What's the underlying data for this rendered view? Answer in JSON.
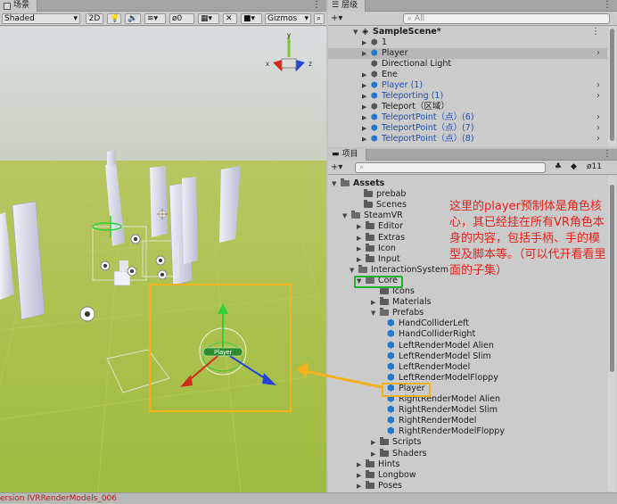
{
  "scene_panel": {
    "tab_label": "场景",
    "shading": "Shaded",
    "toggle_2d": "2D",
    "hidden_count": "0",
    "gizmos": "Gizmos",
    "search_glyph": "All",
    "axis_y": "y",
    "axis_x": "x",
    "axis_z": "z",
    "player_gizmo_label": "Player"
  },
  "hierarchy": {
    "tab_label": "层级",
    "search_placeholder": "All",
    "scene_name": "SampleScene*",
    "rows": [
      {
        "label": "1",
        "blue": false
      },
      {
        "label": "Player",
        "blue": false
      },
      {
        "label": "Directional Light",
        "blue": false
      },
      {
        "label": "Ene",
        "blue": false
      },
      {
        "label": "Player (1)",
        "blue": true
      },
      {
        "label": "Teleporting (1)",
        "blue": true
      },
      {
        "label": "Teleport（区域）",
        "blue": false
      },
      {
        "label": "TeleportPoint（点）(6)",
        "blue": true
      },
      {
        "label": "TeleportPoint（点）(7)",
        "blue": true
      },
      {
        "label": "TeleportPoint（点）(8)",
        "blue": true
      }
    ]
  },
  "project": {
    "tab_label": "项目",
    "hidden_count": "11",
    "rows": [
      {
        "label": "Assets"
      },
      {
        "label": "prebab"
      },
      {
        "label": "Scenes"
      },
      {
        "label": "SteamVR"
      },
      {
        "label": "Editor"
      },
      {
        "label": "Extras"
      },
      {
        "label": "Icon"
      },
      {
        "label": "Input"
      },
      {
        "label": "InteractionSystem"
      },
      {
        "label": "Core"
      },
      {
        "label": "Icons"
      },
      {
        "label": "Materials"
      },
      {
        "label": "Prefabs"
      },
      {
        "label": "HandColliderLeft"
      },
      {
        "label": "HandColliderRight"
      },
      {
        "label": "LeftRenderModel Alien"
      },
      {
        "label": "LeftRenderModel Slim"
      },
      {
        "label": "LeftRenderModel"
      },
      {
        "label": "LeftRenderModelFloppy"
      },
      {
        "label": "Player"
      },
      {
        "label": "RightRenderModel Alien"
      },
      {
        "label": "RightRenderModel Slim"
      },
      {
        "label": "RightRenderModel"
      },
      {
        "label": "RightRenderModelFloppy"
      },
      {
        "label": "Scripts"
      },
      {
        "label": "Shaders"
      },
      {
        "label": "Hints"
      },
      {
        "label": "Longbow"
      },
      {
        "label": "Poses"
      }
    ]
  },
  "annotation_text": "这里的player预制体是角色核心，其已经挂在所有VR角色本身的内容，包括手柄、手的模型及脚本等。（可以代开看看里面的子集）",
  "status_text": "ersion IVRRenderModels_006",
  "colors": {
    "annotation": "#e8201a",
    "highlight_orange": "#f3b21b",
    "highlight_green": "#1db22a",
    "prefab_blue": "#1f78d1",
    "ground": "#a9c24a",
    "status_error": "#b01d1d"
  }
}
